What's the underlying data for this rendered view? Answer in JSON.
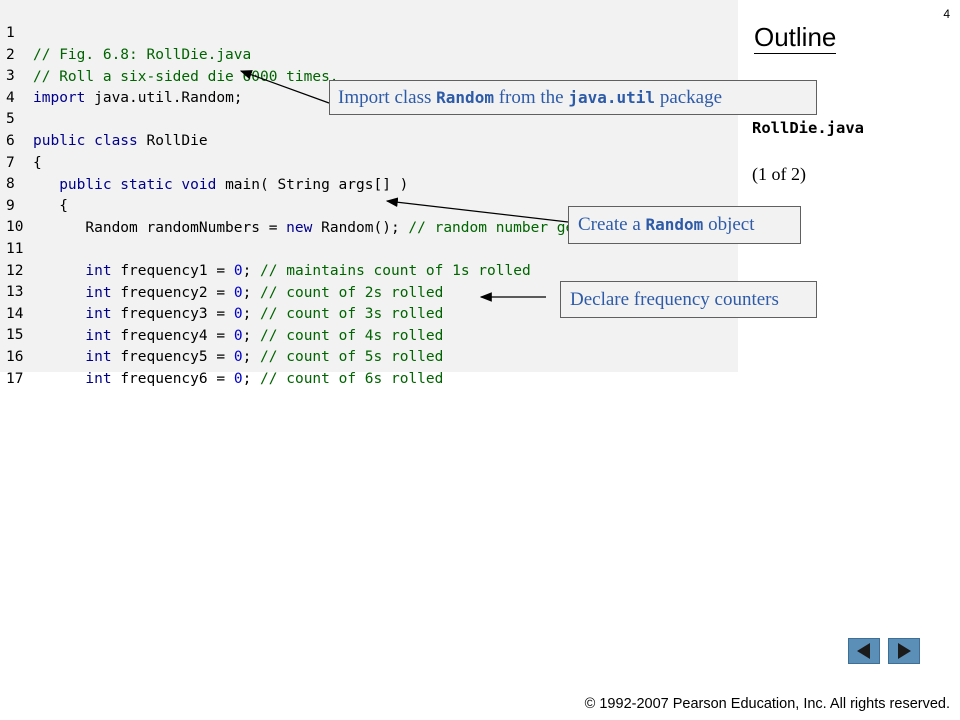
{
  "slide": {
    "page_number": "4",
    "outline_title": "Outline",
    "file_name": "RollDie.java",
    "part_label": "(1 of 2)",
    "copyright_symbol": "©",
    "copyright": " 1992-2007 Pearson Education, Inc.  All rights reserved."
  },
  "code": {
    "line_numbers": [
      "1",
      "2",
      "3",
      "4",
      "5",
      "6",
      "7",
      "8",
      "9",
      "10",
      "11",
      "12",
      "13",
      "14",
      "15",
      "16",
      "17"
    ],
    "l1": "// Fig. 6.8: RollDie.java",
    "l2": "// Roll a six-sided die 6000 times.",
    "l3_kw": "import",
    "l3_rest": " java.util.Random;",
    "l5_kw": "public class",
    "l5_rest": " RollDie",
    "l6": "{",
    "l7_indent": "   ",
    "l7_kw": "public static void",
    "l7_rest": " main( String args[] )",
    "l8": "   {",
    "l9_a": "      Random randomNumbers = ",
    "l9_kw": "new",
    "l9_b": " Random(); ",
    "l9_comment": "// random number generator",
    "int_kw": "int",
    "eq": " = ",
    "zero": "0",
    "semi": "; ",
    "freq_lines": [
      {
        "var": "frequency1",
        "comment": "// maintains count of 1s rolled"
      },
      {
        "var": "frequency2",
        "comment": "// count of 2s rolled"
      },
      {
        "var": "frequency3",
        "comment": "// count of 3s rolled"
      },
      {
        "var": "frequency4",
        "comment": "// count of 4s rolled"
      },
      {
        "var": "frequency5",
        "comment": "// count of 5s rolled"
      },
      {
        "var": "frequency6",
        "comment": "// count of 6s rolled"
      }
    ]
  },
  "callouts": {
    "import": {
      "t1": "Import class ",
      "c1": "Random",
      "t2": " from the ",
      "c2": "java.util",
      "t3": " package"
    },
    "random": {
      "t1": "Create a ",
      "c1": "Random",
      "t2": " object"
    },
    "frequency": "Declare frequency counters"
  },
  "colors": {
    "keyword": "#00008b",
    "comment": "#006400",
    "number": "#0000cc",
    "callout_text": "#2e5ba8",
    "nav_button": "#5b8fb8",
    "panel": "#f2f2f2"
  },
  "nav": {
    "prev_icon": "triangle-left-icon",
    "next_icon": "triangle-right-icon"
  }
}
